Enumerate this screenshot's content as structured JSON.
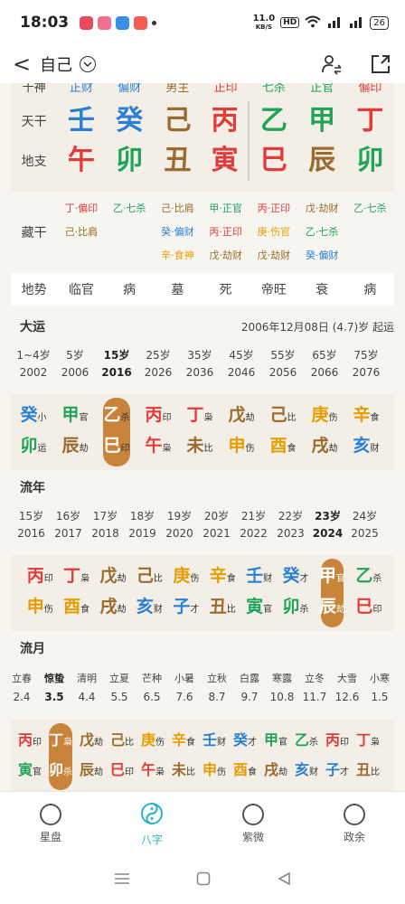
{
  "status": {
    "time": "18:03",
    "net_speed": "11.0",
    "net_unit": "KB/S",
    "hd": "HD",
    "battery": "26"
  },
  "header": {
    "back": "<",
    "title": "自己"
  },
  "pillars": {
    "shishen": [
      "正财",
      "偏财",
      "男主",
      "正印",
      "七杀",
      "正官",
      "偏印"
    ],
    "label_tian": "天干",
    "label_di": "地支",
    "tiangan": [
      "壬",
      "癸",
      "己",
      "丙",
      "乙",
      "甲",
      "丁"
    ],
    "dizhi": [
      "午",
      "卯",
      "丑",
      "寅",
      "巳",
      "辰",
      "卯"
    ],
    "label_zang": "藏干",
    "zanggan": [
      [
        "丁·偏印",
        "己·比肩",
        ""
      ],
      [
        "乙·七杀",
        "",
        ""
      ],
      [
        "己·比肩",
        "癸·偏财",
        "辛·食神"
      ],
      [
        "甲·正官",
        "丙·正印",
        "戊·劫财"
      ],
      [
        "丙·正印",
        "庚·伤官",
        "戊·劫财"
      ],
      [
        "戊·劫财",
        "乙·七杀",
        "癸·偏财"
      ],
      [
        "乙·七杀",
        "",
        ""
      ]
    ],
    "label_dishi": "地势",
    "dishi": [
      "临官",
      "病",
      "墓",
      "死",
      "帝旺",
      "衰",
      "病"
    ]
  },
  "dayun": {
    "title": "大运",
    "start": "2006年12月08日 (4.7)岁 起运",
    "ages": [
      "1~4岁",
      "5岁",
      "15岁",
      "25岁",
      "35岁",
      "45岁",
      "55岁",
      "65岁",
      "75岁"
    ],
    "years": [
      "2002",
      "2006",
      "2016",
      "2026",
      "2036",
      "2046",
      "2056",
      "2066",
      "2076"
    ],
    "gan": [
      [
        "癸",
        "小"
      ],
      [
        "甲",
        "官"
      ],
      [
        "乙",
        "杀"
      ],
      [
        "丙",
        "印"
      ],
      [
        "丁",
        "枭"
      ],
      [
        "戊",
        "劫"
      ],
      [
        "己",
        "比"
      ],
      [
        "庚",
        "伤"
      ],
      [
        "辛",
        "食"
      ]
    ],
    "zhi": [
      [
        "卯",
        "运"
      ],
      [
        "辰",
        "劫"
      ],
      [
        "巳",
        "印"
      ],
      [
        "午",
        "枭"
      ],
      [
        "未",
        "比"
      ],
      [
        "申",
        "伤"
      ],
      [
        "酉",
        "食"
      ],
      [
        "戌",
        "劫"
      ],
      [
        "亥",
        "财"
      ]
    ]
  },
  "liunian": {
    "title": "流年",
    "ages": [
      "15岁",
      "16岁",
      "17岁",
      "18岁",
      "19岁",
      "20岁",
      "21岁",
      "22岁",
      "23岁",
      "24岁"
    ],
    "years": [
      "2016",
      "2017",
      "2018",
      "2019",
      "2020",
      "2021",
      "2022",
      "2023",
      "2024",
      "2025"
    ],
    "gan": [
      [
        "丙",
        "印"
      ],
      [
        "丁",
        "枭"
      ],
      [
        "戊",
        "劫"
      ],
      [
        "己",
        "比"
      ],
      [
        "庚",
        "伤"
      ],
      [
        "辛",
        "食"
      ],
      [
        "壬",
        "财"
      ],
      [
        "癸",
        "才"
      ],
      [
        "甲",
        "官"
      ],
      [
        "乙",
        "杀"
      ]
    ],
    "zhi": [
      [
        "申",
        "伤"
      ],
      [
        "酉",
        "食"
      ],
      [
        "戌",
        "劫"
      ],
      [
        "亥",
        "财"
      ],
      [
        "子",
        "才"
      ],
      [
        "丑",
        "比"
      ],
      [
        "寅",
        "官"
      ],
      [
        "卯",
        "杀"
      ],
      [
        "辰",
        "劫"
      ],
      [
        "巳",
        "印"
      ]
    ]
  },
  "liuyue": {
    "title": "流月",
    "names": [
      "立春",
      "惊蛰",
      "清明",
      "立夏",
      "芒种",
      "小暑",
      "立秋",
      "白露",
      "寒露",
      "立冬",
      "大雪",
      "小寒"
    ],
    "dates": [
      "2.4",
      "3.5",
      "4.4",
      "5.5",
      "6.5",
      "7.6",
      "8.7",
      "9.7",
      "10.8",
      "11.7",
      "12.6",
      "1.5"
    ],
    "gan": [
      [
        "丙",
        "印"
      ],
      [
        "丁",
        "枭"
      ],
      [
        "戊",
        "劫"
      ],
      [
        "己",
        "比"
      ],
      [
        "庚",
        "伤"
      ],
      [
        "辛",
        "食"
      ],
      [
        "壬",
        "财"
      ],
      [
        "癸",
        "才"
      ],
      [
        "甲",
        "官"
      ],
      [
        "乙",
        "杀"
      ],
      [
        "丙",
        "印"
      ],
      [
        "丁",
        "枭"
      ]
    ],
    "zhi": [
      [
        "寅",
        "官"
      ],
      [
        "卯",
        "杀"
      ],
      [
        "辰",
        "劫"
      ],
      [
        "巳",
        "印"
      ],
      [
        "午",
        "枭"
      ],
      [
        "未",
        "比"
      ],
      [
        "申",
        "伤"
      ],
      [
        "酉",
        "食"
      ],
      [
        "戌",
        "劫"
      ],
      [
        "亥",
        "财"
      ],
      [
        "子",
        "才"
      ],
      [
        "丑",
        "比"
      ]
    ]
  },
  "nav": [
    "星盘",
    "八字",
    "紫微",
    "政余"
  ],
  "colors": {
    "water": "#2a7fd4",
    "wood": "#21a35a",
    "earth": "#9a6a2e",
    "fire": "#e23b3b",
    "metal": "#e69d00",
    "accent": "#2bb3c0",
    "highlight": "#c8843a"
  }
}
